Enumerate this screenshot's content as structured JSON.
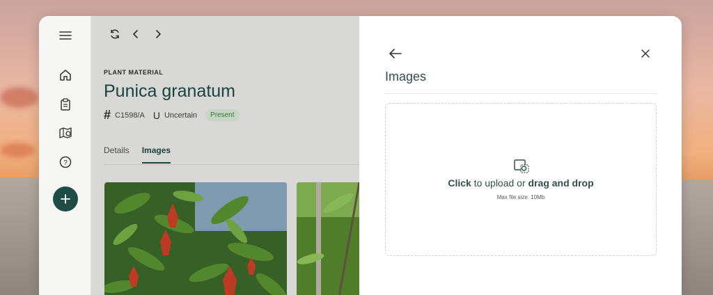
{
  "toolbar": {
    "icons": [
      "refresh-icon",
      "chevron-left-icon",
      "chevron-right-icon"
    ]
  },
  "sidebar": {
    "items": [
      "menu-icon",
      "home-icon",
      "clipboard-icon",
      "map-pin-icon",
      "help-icon"
    ],
    "fab": "plus-icon"
  },
  "record": {
    "eyebrow": "PLANT MATERIAL",
    "title": "Punica granatum",
    "id_symbol": "#",
    "id": "C1598/A",
    "provenance_symbol": "U",
    "provenance": "Uncertain",
    "status": "Present"
  },
  "tabs": [
    {
      "label": "Details",
      "active": false
    },
    {
      "label": "Images",
      "active": true
    }
  ],
  "panel": {
    "title": "Images",
    "dropzone": {
      "click_text": "Click",
      "middle_text": " to upload or ",
      "drag_text": "drag and drop",
      "max_size": "Max file size. 10Mb"
    }
  },
  "colors": {
    "accent": "#1f4d46",
    "badge_bg": "#e3f3e2",
    "badge_text": "#3a8a45"
  }
}
